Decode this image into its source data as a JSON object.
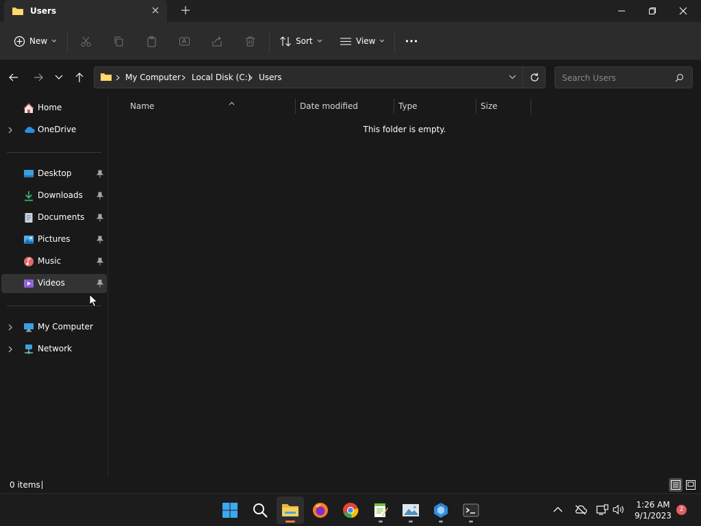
{
  "window": {
    "tab_title": "Users",
    "new_tab": "+"
  },
  "toolbar": {
    "new_label": "New",
    "sort_label": "Sort",
    "view_label": "View"
  },
  "address": {
    "crumbs": [
      "My Computer",
      "Local Disk (C:)",
      "Users"
    ]
  },
  "search": {
    "placeholder": "Search Users"
  },
  "sidebar": {
    "home": "Home",
    "onedrive": "OneDrive",
    "pinned": [
      "Desktop",
      "Downloads",
      "Documents",
      "Pictures",
      "Music",
      "Videos"
    ],
    "my_computer": "My Computer",
    "network": "Network"
  },
  "columns": {
    "name": "Name",
    "date_modified": "Date modified",
    "type": "Type",
    "size": "Size"
  },
  "content": {
    "empty_message": "This folder is empty."
  },
  "status": {
    "count": "0 items"
  },
  "taskbar": {
    "time": "1:26 AM",
    "date": "9/1/2023",
    "notifications": "2"
  },
  "colors": {
    "accent": "#f07c50",
    "folder": "#f8cf5a",
    "background": "#191919",
    "toolbar": "#2c2c2c"
  }
}
